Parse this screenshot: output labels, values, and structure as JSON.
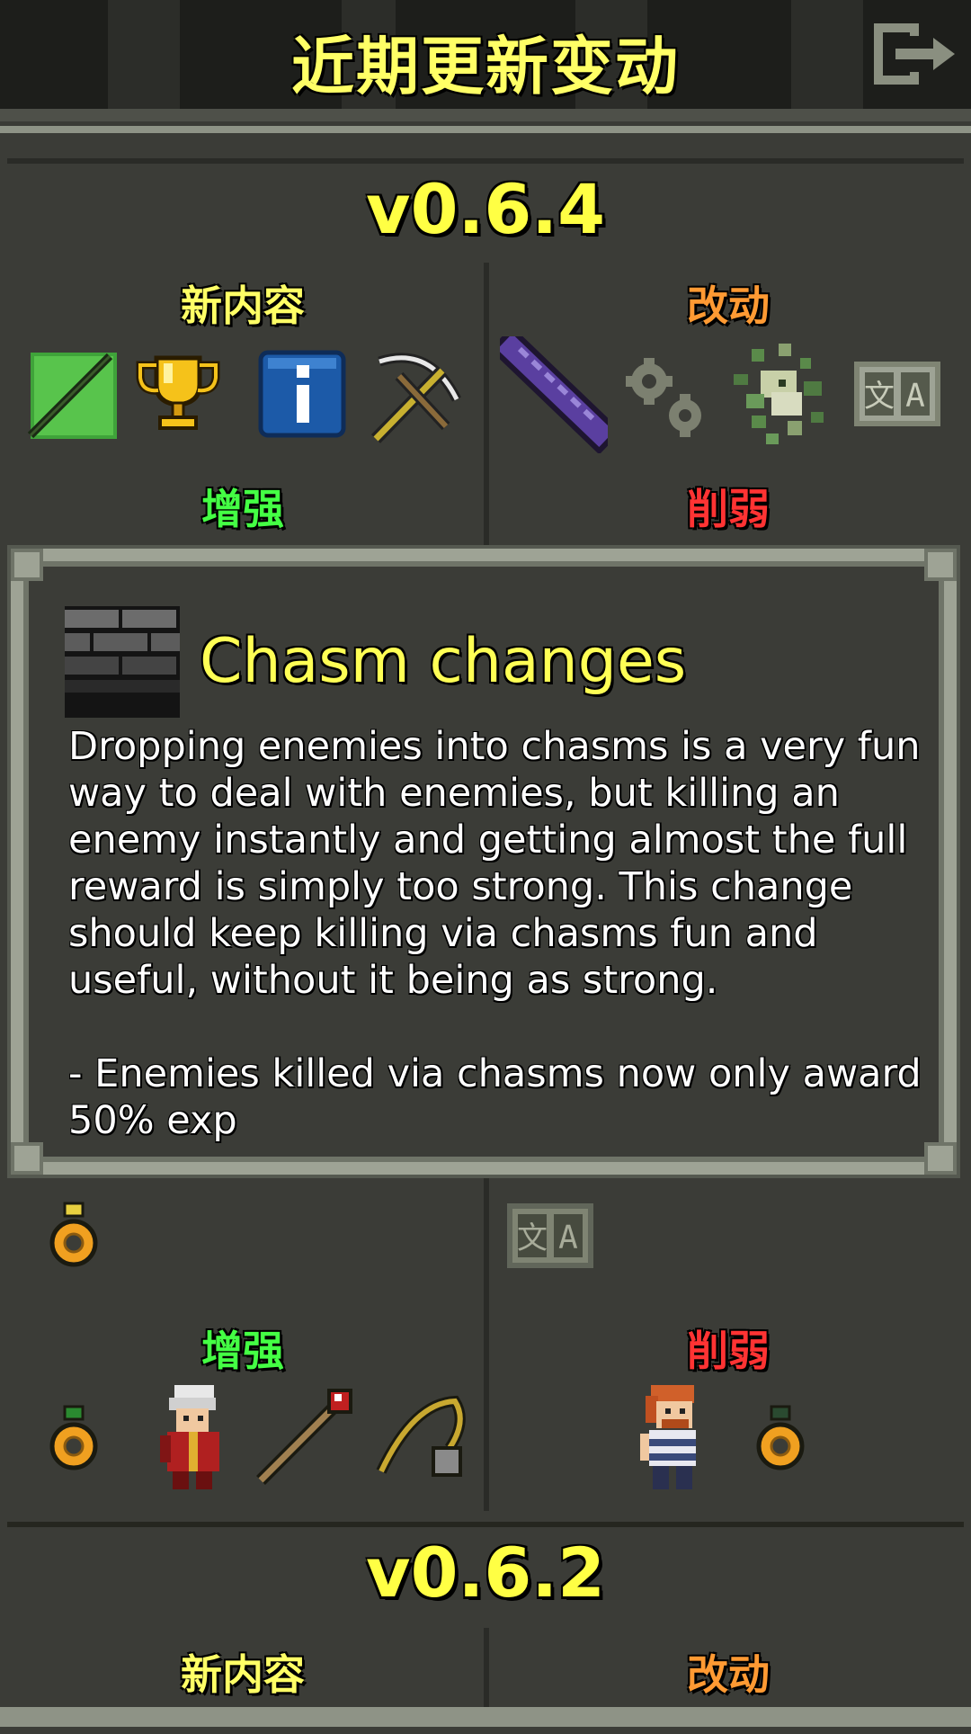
{
  "header": {
    "title": "近期更新变动"
  },
  "versions": [
    {
      "version": "v0.6.4",
      "sections": {
        "new_content": "新内容",
        "changes": "改动",
        "buffs": "增强",
        "nerfs": "削弱"
      }
    },
    {
      "version": "v0.6.2",
      "sections": {
        "new_content": "新内容",
        "changes": "改动"
      }
    }
  ],
  "lower_sections": {
    "buffs": "增强",
    "nerfs": "削弱"
  },
  "popup": {
    "title": "Chasm changes",
    "body": "Dropping enemies into chasms is a very fun way to deal with enemies, but killing an enemy instantly and getting almost the full reward is simply too strong. This change should keep killing via chasms fun and useful, without it being as strong.\n\n- Enemies killed via chasms now only award 50% exp",
    "icon": "chasm-icon"
  },
  "colors": {
    "title": "#ffff66",
    "new_content": "#ffff66",
    "changes": "#ff9a33",
    "buffs": "#44ff44",
    "nerfs": "#ff3333"
  },
  "icons": {
    "exit": "exit-icon",
    "v064_new": [
      "wand-icon",
      "trophy-icon",
      "info-icon",
      "crossbow-icon"
    ],
    "v064_changes": [
      "purple-wand-icon",
      "gears-icon",
      "plant-icon",
      "language-icon"
    ],
    "lower_left": [
      "ring-icon"
    ],
    "lower_right": [
      "language-icon"
    ],
    "buffs": [
      "ring-icon",
      "mage-hero-icon",
      "staff-icon",
      "whip-icon"
    ],
    "nerfs": [
      "warrior-hero-icon",
      "ring-icon"
    ]
  }
}
